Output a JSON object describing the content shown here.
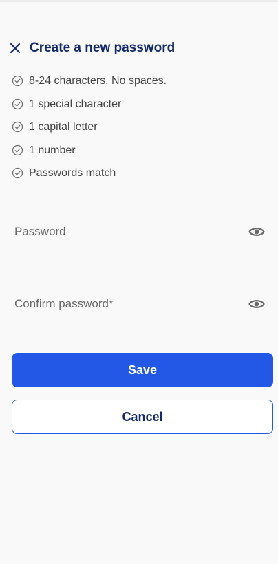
{
  "header": {
    "title": "Create a new password",
    "close_icon": "close-icon"
  },
  "rules": [
    {
      "label": "8-24 characters. No spaces.",
      "icon": "check-circle-icon"
    },
    {
      "label": "1 special character",
      "icon": "check-circle-icon"
    },
    {
      "label": "1 capital letter",
      "icon": "check-circle-icon"
    },
    {
      "label": "1 number",
      "icon": "check-circle-icon"
    },
    {
      "label": "Passwords match",
      "icon": "check-circle-icon"
    }
  ],
  "form": {
    "password": {
      "value": "",
      "placeholder": "Password",
      "icon": "eye-icon"
    },
    "confirm_password": {
      "value": "",
      "placeholder": "Confirm password*",
      "icon": "eye-icon"
    }
  },
  "actions": {
    "save_label": "Save",
    "cancel_label": "Cancel"
  },
  "colors": {
    "primary": "#2357e5",
    "title": "#14296b",
    "background": "#f9f9f9",
    "text": "#444444",
    "icon": "#6a6a6a"
  }
}
